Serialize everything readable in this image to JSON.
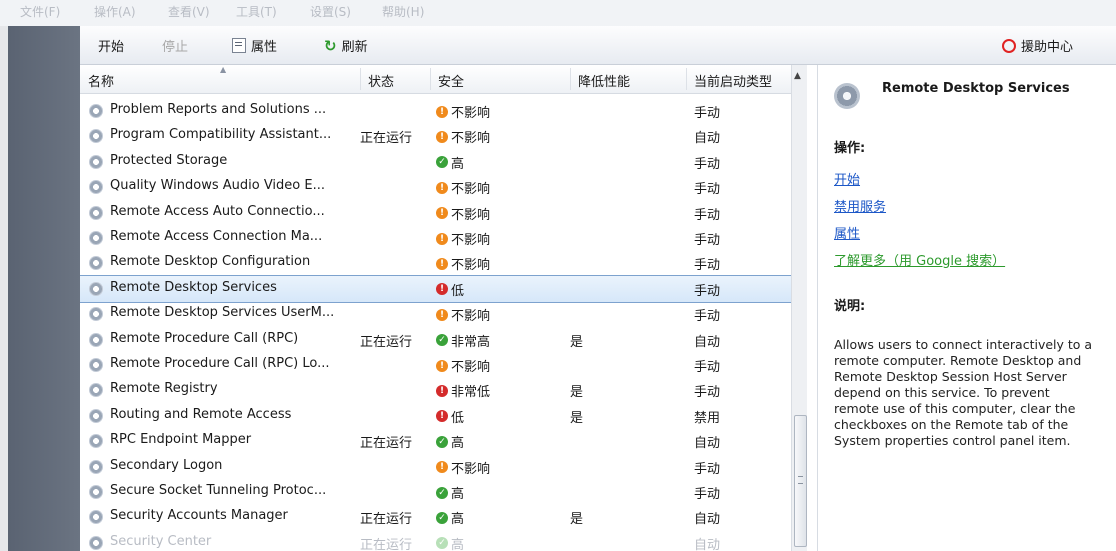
{
  "menubar": [
    "文件(F)",
    "操作(A)",
    "查看(V)",
    "工具(T)",
    "设置(S)",
    "帮助(H)"
  ],
  "toolbar": {
    "start": "开始",
    "stop": "停止",
    "properties": "属性",
    "refresh": "刷新",
    "help": "援助中心"
  },
  "columns": {
    "name": "名称",
    "status": "状态",
    "security": "安全",
    "performance": "降低性能",
    "startup": "当前启动类型"
  },
  "colors": {
    "not_affected": "#f08a1c",
    "high": "#3aa23a",
    "low": "#d42b2b",
    "selected_border": "#7da2ce",
    "link": "#1c57c7",
    "link_green": "#2d9a2d"
  },
  "services": [
    {
      "name": "Problem Reports and Solutions ...",
      "status": "",
      "security": "不影响",
      "level": "warn",
      "perf": "",
      "startup": "手动"
    },
    {
      "name": "Program Compatibility Assistant...",
      "status": "正在运行",
      "security": "不影响",
      "level": "warn",
      "perf": "",
      "startup": "自动"
    },
    {
      "name": "Protected Storage",
      "status": "",
      "security": "高",
      "level": "ok",
      "perf": "",
      "startup": "手动"
    },
    {
      "name": "Quality Windows Audio Video E...",
      "status": "",
      "security": "不影响",
      "level": "warn",
      "perf": "",
      "startup": "手动"
    },
    {
      "name": "Remote Access Auto Connectio...",
      "status": "",
      "security": "不影响",
      "level": "warn",
      "perf": "",
      "startup": "手动"
    },
    {
      "name": "Remote Access Connection Ma...",
      "status": "",
      "security": "不影响",
      "level": "warn",
      "perf": "",
      "startup": "手动"
    },
    {
      "name": "Remote Desktop Configuration",
      "status": "",
      "security": "不影响",
      "level": "warn",
      "perf": "",
      "startup": "手动"
    },
    {
      "name": "Remote Desktop Services",
      "status": "",
      "security": "低",
      "level": "bad",
      "perf": "",
      "startup": "手动",
      "selected": true
    },
    {
      "name": "Remote Desktop Services UserM...",
      "status": "",
      "security": "不影响",
      "level": "warn",
      "perf": "",
      "startup": "手动"
    },
    {
      "name": "Remote Procedure Call (RPC)",
      "status": "正在运行",
      "security": "非常高",
      "level": "ok",
      "perf": "是",
      "startup": "自动"
    },
    {
      "name": "Remote Procedure Call (RPC) Lo...",
      "status": "",
      "security": "不影响",
      "level": "warn",
      "perf": "",
      "startup": "手动"
    },
    {
      "name": "Remote Registry",
      "status": "",
      "security": "非常低",
      "level": "bad",
      "perf": "是",
      "startup": "手动"
    },
    {
      "name": "Routing and Remote Access",
      "status": "",
      "security": "低",
      "level": "bad",
      "perf": "是",
      "startup": "禁用"
    },
    {
      "name": "RPC Endpoint Mapper",
      "status": "正在运行",
      "security": "高",
      "level": "ok",
      "perf": "",
      "startup": "自动"
    },
    {
      "name": "Secondary Logon",
      "status": "",
      "security": "不影响",
      "level": "warn",
      "perf": "",
      "startup": "手动"
    },
    {
      "name": "Secure Socket Tunneling Protoc...",
      "status": "",
      "security": "高",
      "level": "ok",
      "perf": "",
      "startup": "手动"
    },
    {
      "name": "Security Accounts Manager",
      "status": "正在运行",
      "security": "高",
      "level": "ok",
      "perf": "是",
      "startup": "自动"
    },
    {
      "name": "Security Center",
      "status": "正在运行",
      "security": "高",
      "level": "ok",
      "perf": "",
      "startup": "自动",
      "faded": true
    }
  ],
  "panel": {
    "title": "Remote Desktop Services",
    "actions_heading": "操作:",
    "actions": [
      "开始",
      "禁用服务",
      "属性"
    ],
    "learn_more": "了解更多（用 Google 搜索）",
    "description_heading": "说明:",
    "description": "Allows users to connect interactively to a remote computer. Remote Desktop and Remote Desktop Session Host Server depend on this service.  To prevent remote use of this computer, clear the checkboxes on the Remote tab of the System properties control panel item."
  }
}
